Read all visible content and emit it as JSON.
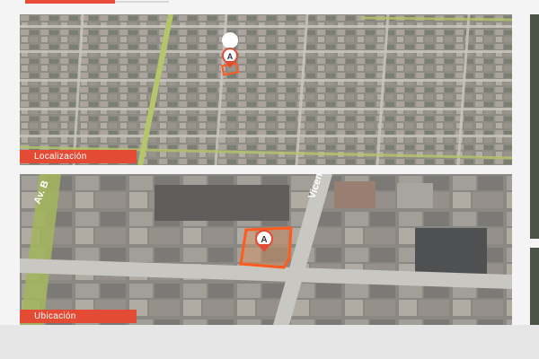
{
  "panels": {
    "localizacion": {
      "label": "Localización"
    },
    "ubicacion": {
      "label": "Ubicación"
    }
  },
  "map_labels": {
    "avenue": "Av. B",
    "street": "Vicente"
  },
  "marker": {
    "letter": "A"
  },
  "colors": {
    "accent": "#e44b34",
    "parcel_outline": "#ff5a1f",
    "road_green": "#b5c66a",
    "block_tone": "#9d9a93"
  },
  "icons": {
    "marker": "map-pin-icon"
  }
}
